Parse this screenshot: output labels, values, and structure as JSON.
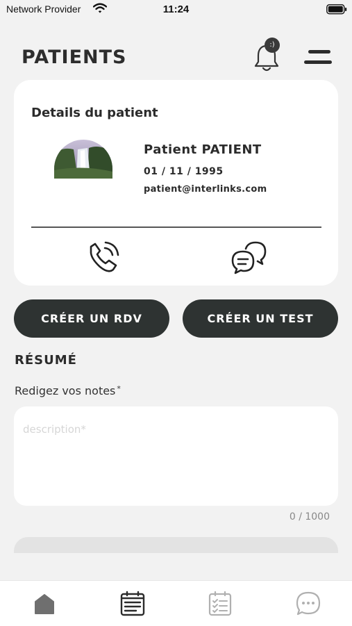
{
  "status_bar": {
    "carrier": "Network Provider",
    "time": "11:24"
  },
  "header": {
    "title": "PATIENTS",
    "notification_badge": ":)"
  },
  "patient_card": {
    "title": "Details du patient",
    "name": "Patient PATIENT",
    "birth_date": "01 / 11 / 1995",
    "email": "patient@interlinks.com"
  },
  "actions": {
    "create_appointment": "CRÉER UN RDV",
    "create_test": "CRÉER UN TEST"
  },
  "summary": {
    "title": "RÉSUMÉ",
    "notes_label": "Redigez vos notes",
    "required_mark": "*",
    "placeholder": "description*",
    "counter": "0 / 1000"
  },
  "colors": {
    "primary_dark": "#2e3332",
    "background": "#f2f2f2",
    "card": "#ffffff",
    "tab_inactive": "#b0b0b0"
  },
  "tab_bar": {
    "items": [
      {
        "icon": "home-icon",
        "active": false
      },
      {
        "icon": "calendar-list-icon",
        "active": true
      },
      {
        "icon": "checklist-icon",
        "active": false
      },
      {
        "icon": "chat-icon",
        "active": false
      }
    ]
  }
}
